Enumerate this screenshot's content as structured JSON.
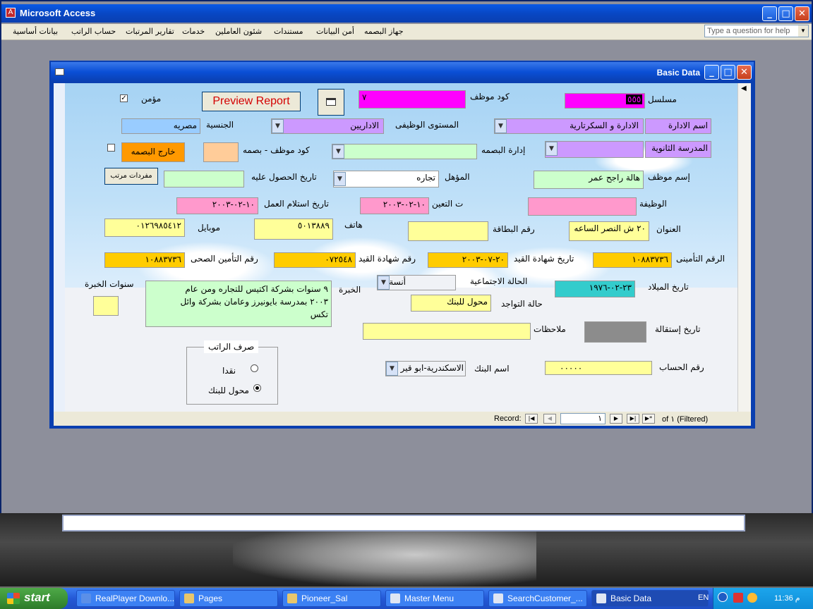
{
  "app": {
    "title": "Microsoft Access"
  },
  "menu": {
    "items": [
      "بيانات أساسية",
      "حساب الراتب",
      "تقارير المرتبات",
      "خدمات",
      "شئون العاملين",
      "مستندات",
      "أمن البيانات",
      "جهاز البصمه"
    ],
    "help_placeholder": "Type a question for help"
  },
  "form": {
    "title": "Basic Data",
    "preview_button": "Preview Report",
    "mu_min": "مؤمن",
    "emp_code_label": "كود موظف",
    "emp_code": "٧",
    "serial_label": "مسلسل",
    "serial": "٥٥٥",
    "dept_label": "اسم الادارة",
    "dept": "الادارة و السكرتارية",
    "level_label": "المستوى الوظيفى",
    "level": "الاداريين",
    "nationality_label": "الجنسية",
    "nationality": "مصريه",
    "school_label": "المدرسة الثانوية",
    "school": "",
    "fp_dept_label": "إدارة البصمه",
    "fp_dept": "",
    "fp_code_label": "كود موظف - بصمه",
    "fp_code": "",
    "outside_fp": "خارج البصمه",
    "name_label": "إسم موظف",
    "name": "هالة راجح عمر",
    "qual_label": "المؤهل",
    "qual": "تجاره",
    "qual_date_label": "تاريخ الحصول عليه",
    "qual_date": "",
    "salary_items_button": "مفردات مرتب",
    "job_label": "الوظيفة",
    "job": "",
    "hire_date_label": "ت التعين",
    "hire_date": "١٠-٠٢-٢٠٠٣",
    "start_date_label": "تاريخ استلام العمل",
    "start_date": "١٠-٠٢-٢٠٠٣",
    "address_label": "العنوان",
    "address": "٢٠ ش النصر الساعه",
    "card_label": "رقم البطاقة",
    "card": "",
    "phone_label": "هاتف",
    "phone": "٥٠١٣٨٨٩",
    "mobile_label": "موبايل",
    "mobile": "٠١٢٦٩٨٥٤١٢",
    "insurance_label": "الرقم التأمينى",
    "insurance": "١٠٨٨٣٧٣٦",
    "reg_date_label": "تاريخ شهادة القيد",
    "reg_date": "٢٠-٠٧-٢٠٠٣",
    "reg_no_label": "رقم شهادة القيد",
    "reg_no": "٠٧٢٥٤٨",
    "health_label": "رقم التأمين الصحى",
    "health": "١٠٨٨٣٧٣٦",
    "birth_label": "تاريخ الميلاد",
    "birth": "٢٣-٠٢-١٩٧٦",
    "marital_label": "الحالة الاجتماعية",
    "marital": "أنسة",
    "experience_label": "الخبرة",
    "experience_line1": "٩ سنوات بشركة اكتيس للتجاره ومن عام",
    "experience_line2": "٢٠٠٣ بمدرسة بايونيرز وعامان بشركة وائل",
    "experience_line3": "تكس",
    "exp_years_label": "سنوات الخبرة",
    "exp_years": "",
    "presence_label": "حالة التواجد",
    "presence": "محول للبنك",
    "resign_label": "تاريخ إستقالة",
    "notes_label": "ملاحظات",
    "notes": "",
    "pay_group_label": "صرف الراتب",
    "pay_cash": "نقدا",
    "pay_bank": "محول للبنك",
    "bank_label": "اسم البنك",
    "bank": "الاسكندرية-ابو قير",
    "account_label": "رقم الحساب",
    "account": "٠٠٠٠٠"
  },
  "record_nav": {
    "label": "Record:",
    "current": "١",
    "of_text": "of  ١ (Filtered)"
  },
  "taskbar": {
    "start": "start",
    "tasks": [
      "RealPlayer Downlo...",
      "Pages",
      "Pioneer_Sal",
      "Master Menu",
      "SearchCustomer_...",
      "Basic Data"
    ],
    "lang": "EN",
    "clock": "11:36 م"
  },
  "colors": {
    "magenta": "#ff00ff",
    "lavender": "#cc99ff",
    "light_yellow": "#ffff99",
    "gold": "#ffcc00",
    "pink": "#ff99cc",
    "teal": "#33cccc",
    "mint": "#ccffcc",
    "orange": "#ff9900",
    "peach": "#ffcc99",
    "sky": "#99ccff"
  }
}
